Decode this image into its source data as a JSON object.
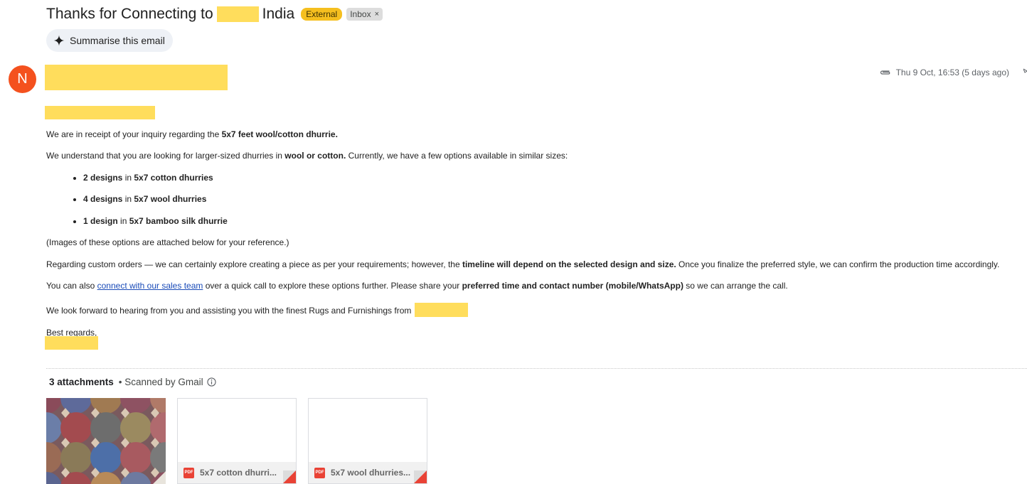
{
  "subject": {
    "text_before": "Thanks for Connecting to",
    "text_after": "India",
    "label_external": "External",
    "label_inbox": "Inbox",
    "label_inbox_close": "×"
  },
  "summarise": {
    "label": "Summarise this email",
    "icon": "sparkle-icon"
  },
  "sender": {
    "avatar_letter": "N",
    "avatar_color": "#f4511e"
  },
  "header": {
    "date": "Thu 9 Oct, 16:53 (5 days ago)",
    "icon": "paperclip-icon"
  },
  "body": {
    "p1_a": "We are in receipt of your inquiry regarding the ",
    "p1_b": "5x7 feet wool/cotton dhurrie.",
    "p2_a": "We understand that you are looking for larger-sized dhurries in ",
    "p2_b": "wool or cotton.",
    "p2_c": " Currently, we have a few options available in similar sizes:",
    "bullets": [
      {
        "count": "2 designs",
        "in": " in ",
        "item": "5x7 cotton dhurries"
      },
      {
        "count": "4 designs",
        "in": " in ",
        "item": "5x7 wool dhurries"
      },
      {
        "count": "1 design",
        "in": " in ",
        "item": "5x7 bamboo silk dhurrie"
      }
    ],
    "p3": "(Images of these options are attached below for your reference.)",
    "p4_a": "Regarding custom orders — we can certainly explore creating a piece as per your requirements; however, the ",
    "p4_b": "timeline will depend on the selected design and size.",
    "p4_c": " Once you finalize the preferred style, we can confirm the production time accordingly.",
    "p5_a": "You can also ",
    "p5_link": "connect with our sales team",
    "p5_b": " over a quick call to explore these options further. Please share your ",
    "p5_bold": "preferred time and contact number (mobile/WhatsApp)",
    "p5_c": " so we can arrange the call.",
    "p6": "We look forward to hearing from you and assisting you with the finest Rugs and Furnishings from ",
    "p7": "Best regards,"
  },
  "attachments": {
    "count_label": "3 attachments",
    "scanned_label": "• Scanned by Gmail",
    "files": [
      {
        "name": "5x7 cotton dhurri...",
        "type": "PDF"
      },
      {
        "name": "5x7 wool dhurries...",
        "type": "PDF"
      }
    ]
  },
  "colors": {
    "redaction": "#ffdd5c",
    "external_label": "#f5bf1f",
    "link": "#1a4bb8",
    "pdf_red": "#e94235"
  }
}
